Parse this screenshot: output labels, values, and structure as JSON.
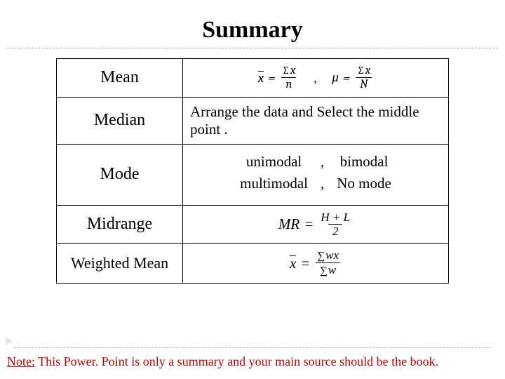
{
  "title": "Summary",
  "rows": {
    "mean": {
      "label": "Mean",
      "f1": {
        "lhs_var": "x",
        "lhs_bar": true,
        "eq": "=",
        "num": "x",
        "den": "n",
        "sum_num": true
      },
      "sep": ",",
      "f2": {
        "lhs_var": "μ",
        "lhs_bar": false,
        "eq": "=",
        "num": "x",
        "den": "N",
        "sum_num": true
      }
    },
    "median": {
      "label": "Median",
      "text": "Arrange the data  and Select the middle point ."
    },
    "mode": {
      "label": "Mode",
      "items": [
        [
          "unimodal",
          ",",
          "bimodal"
        ],
        [
          "multimodal",
          ",",
          "No mode"
        ]
      ]
    },
    "midrange": {
      "label": "Midrange",
      "f": {
        "lhs": "MR",
        "eq": "=",
        "num": "H + L",
        "den": "2"
      }
    },
    "weighted": {
      "label": "Weighted Mean",
      "f": {
        "lhs_var": "x",
        "lhs_bar": true,
        "eq": "=",
        "num": "wx",
        "den": "w",
        "sum_num": true,
        "sum_den": true
      }
    }
  },
  "note": {
    "prefix": "Note:",
    "rest": " This Power. Point is only a summary and your main source should be the book."
  }
}
